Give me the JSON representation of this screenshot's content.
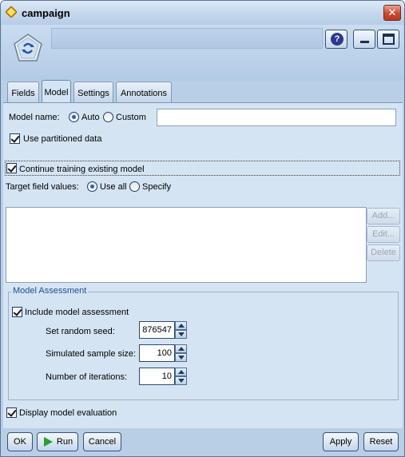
{
  "window": {
    "title": "campaign",
    "close_glyph": "✕"
  },
  "header": {
    "help_glyph": "?"
  },
  "tabs": [
    "Fields",
    "Model",
    "Settings",
    "Annotations"
  ],
  "model": {
    "name_label": "Model name:",
    "auto_label": "Auto",
    "custom_label": "Custom",
    "use_partitioned_label": "Use partitioned data",
    "continue_training_label": "Continue training existing model",
    "target_values_label": "Target field values:",
    "use_all_label": "Use all",
    "specify_label": "Specify",
    "add_label": "Add...",
    "edit_label": "Edit...",
    "delete_label": "Delete"
  },
  "assessment": {
    "title": "Model Assessment",
    "include_label": "Include model assessment",
    "seed_label": "Set random seed:",
    "seed_value": "876547",
    "sample_label": "Simulated sample size:",
    "sample_value": "100",
    "iterations_label": "Number of iterations:",
    "iterations_value": "10"
  },
  "display_eval_label": "Display model evaluation",
  "buttons": {
    "ok": "OK",
    "run": "Run",
    "cancel": "Cancel",
    "apply": "Apply",
    "reset": "Reset"
  },
  "colors": {
    "window_bg": "#b9cfe6",
    "panel_bg": "#d5e4f3",
    "close_red": "#c9482e",
    "run_green": "#2c9e2c"
  }
}
